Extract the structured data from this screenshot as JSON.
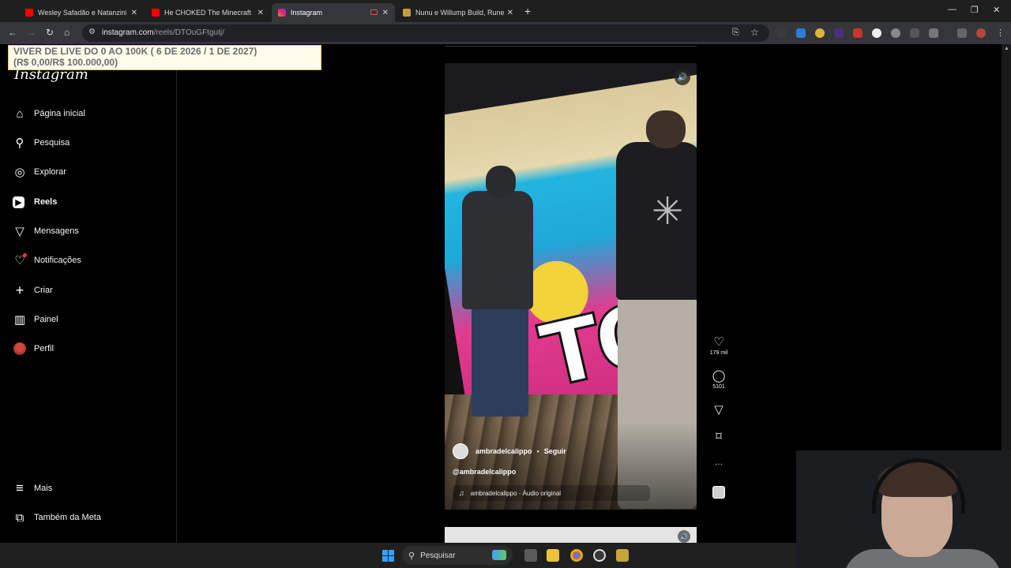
{
  "browser": {
    "tabs": [
      {
        "title": "Wesley Safadão e Natanzinho L",
        "favicon_color": "#ff0000",
        "active": false
      },
      {
        "title": "He CHOKED The Minecraft Wo",
        "favicon_color": "#ff0000",
        "active": false
      },
      {
        "title": "Instagram",
        "favicon_color": "#e1306c",
        "active": true
      },
      {
        "title": "Nunu e Willump Build, Runes &",
        "favicon_color": "#c89b3c",
        "active": false
      }
    ],
    "new_tab_symbol": "+",
    "window_controls": {
      "minimize": "—",
      "restore": "❐",
      "close": "✕"
    },
    "nav": {
      "back": "←",
      "forward": "→",
      "reload": "↻",
      "home": "⌂"
    },
    "url_host": "instagram.com",
    "url_path": "/reels/DTOuGFtgutj/",
    "address_icon": "site-info-icon"
  },
  "banner": {
    "line1": "VIVER DE LIVE DO 0 AO 100K ( 6 DE 2026 / 1 DE 2027)",
    "line2": "(R$ 0,00/R$ 100.000,00)"
  },
  "sidebar": {
    "logo": "Instagram",
    "items": [
      {
        "label": "Página inicial",
        "icon": "⌂"
      },
      {
        "label": "Pesquisa",
        "icon": "⚲"
      },
      {
        "label": "Explorar",
        "icon": "◎"
      },
      {
        "label": "Reels",
        "icon": "▶"
      },
      {
        "label": "Mensagens",
        "icon": "▽"
      },
      {
        "label": "Notificações",
        "icon": "♡"
      },
      {
        "label": "Criar",
        "icon": "+"
      },
      {
        "label": "Painel",
        "icon": "▥"
      },
      {
        "label": "Perfil",
        "icon": ""
      }
    ],
    "bottom_items": [
      {
        "label": "Mais",
        "icon": "≡"
      },
      {
        "label": "Também da Meta",
        "icon": "⧉"
      }
    ]
  },
  "reel": {
    "author": "ambradelcalippo",
    "separator": "•",
    "follow_label": "Seguir",
    "caption": "@ambradelcalippo",
    "audio_icon": "♫",
    "audio": "ambradelcalippo · Áudio original",
    "mute_icon": "🔊",
    "video_text": "TO"
  },
  "actions": {
    "likes": "179 mil",
    "comments": "5101",
    "like_icon": "♡",
    "comment_icon": "◯",
    "share_icon": "▽",
    "save_icon": "⌑",
    "more_icon": "···"
  },
  "taskbar": {
    "search_placeholder": "Pesquisar",
    "search_icon": "⚲"
  },
  "colors": {
    "background": "#000000",
    "accent": "#3aa0ff",
    "notification": "#ff3040",
    "banner_bg": "#fffbea"
  }
}
